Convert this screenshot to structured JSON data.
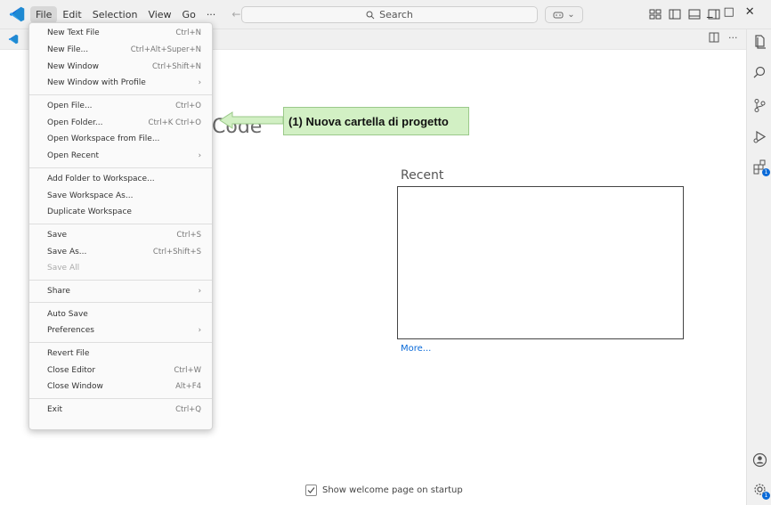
{
  "menubar": [
    "File",
    "Edit",
    "Selection",
    "View",
    "Go",
    "···"
  ],
  "search": {
    "label": "Search"
  },
  "welcome": {
    "title": "Code",
    "recent_heading": "Recent",
    "more_link": "More...",
    "startup_checkbox": "Show welcome page on startup"
  },
  "annotation": {
    "text": "(1) Nuova cartella di progetto"
  },
  "file_menu": {
    "groups": [
      [
        {
          "label": "New Text File",
          "key": "Ctrl+N"
        },
        {
          "label": "New File...",
          "key": "Ctrl+Alt+Super+N"
        },
        {
          "label": "New Window",
          "key": "Ctrl+Shift+N"
        },
        {
          "label": "New Window with Profile",
          "key": "›"
        }
      ],
      [
        {
          "label": "Open File...",
          "key": "Ctrl+O"
        },
        {
          "label": "Open Folder...",
          "key": "Ctrl+K Ctrl+O"
        },
        {
          "label": "Open Workspace from File...",
          "key": ""
        },
        {
          "label": "Open Recent",
          "key": "›"
        }
      ],
      [
        {
          "label": "Add Folder to Workspace...",
          "key": ""
        },
        {
          "label": "Save Workspace As...",
          "key": ""
        },
        {
          "label": "Duplicate Workspace",
          "key": ""
        }
      ],
      [
        {
          "label": "Save",
          "key": "Ctrl+S"
        },
        {
          "label": "Save As...",
          "key": "Ctrl+Shift+S"
        },
        {
          "label": "Save All",
          "key": "",
          "disabled": true
        }
      ],
      [
        {
          "label": "Share",
          "key": "›"
        }
      ],
      [
        {
          "label": "Auto Save",
          "key": ""
        },
        {
          "label": "Preferences",
          "key": "›"
        }
      ],
      [
        {
          "label": "Revert File",
          "key": ""
        },
        {
          "label": "Close Editor",
          "key": "Ctrl+W"
        },
        {
          "label": "Close Window",
          "key": "Alt+F4"
        }
      ],
      [
        {
          "label": "Exit",
          "key": "Ctrl+Q"
        }
      ]
    ]
  },
  "badges": {
    "extensions": "1",
    "settings": "1"
  },
  "colors": {
    "accent": "#0a6ad8",
    "callout_bg": "#d2f0c4"
  }
}
